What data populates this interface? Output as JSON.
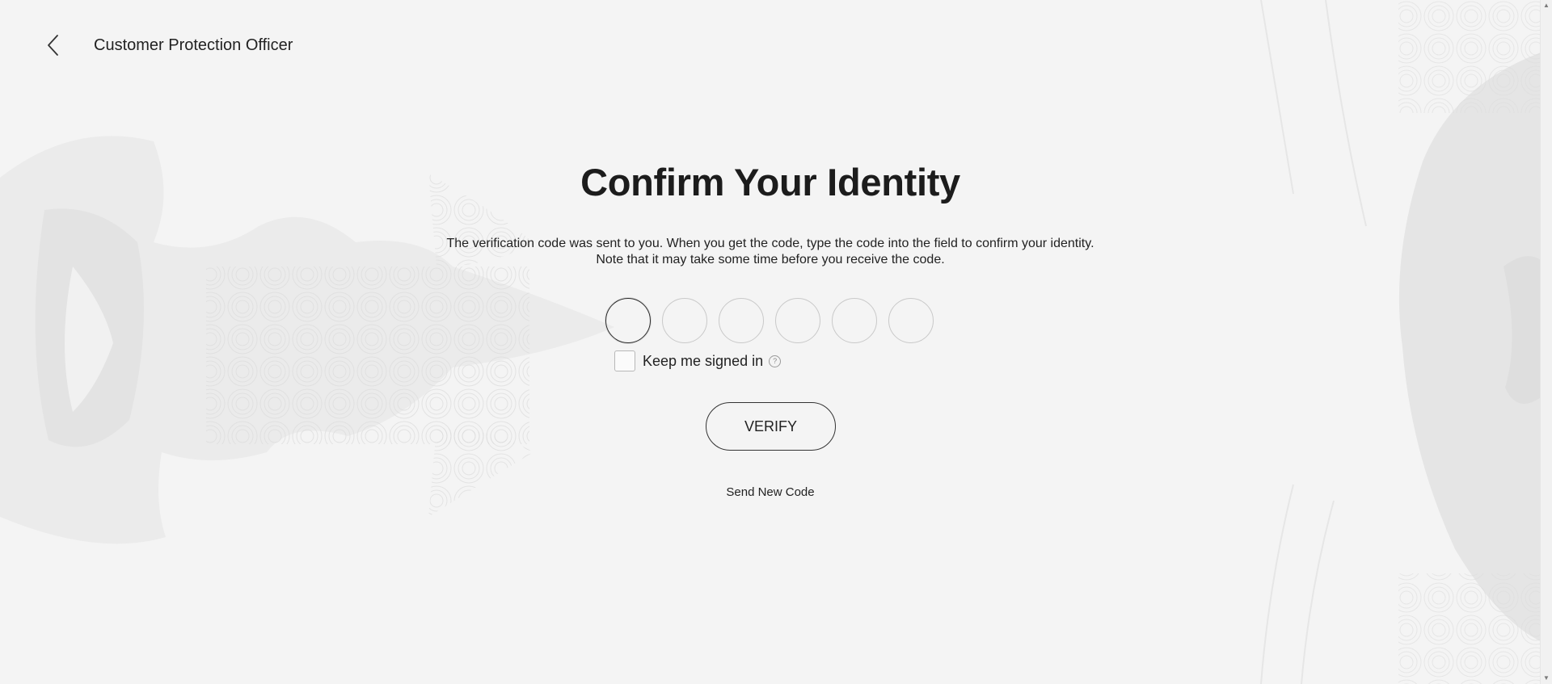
{
  "header": {
    "title": "Customer Protection Officer",
    "back_icon": "chevron-left-icon"
  },
  "main": {
    "heading": "Confirm Your Identity",
    "description_line1": "The verification code was sent to you. When you get the code, type the code into the field to confirm your identity.",
    "description_line2": "Note that it may take some time before you receive the code.",
    "code_digits": [
      "",
      "",
      "",
      "",
      "",
      ""
    ],
    "keep_signed_in_label": "Keep me signed in",
    "keep_signed_in_checked": false,
    "help_glyph": "?",
    "verify_label": "VERIFY",
    "send_new_code_label": "Send New Code"
  },
  "scrollbar": {
    "up_glyph": "▲",
    "down_glyph": "▼"
  },
  "colors": {
    "background": "#f4f4f4",
    "text": "#1a1a1a",
    "border": "#c9c9c9"
  }
}
